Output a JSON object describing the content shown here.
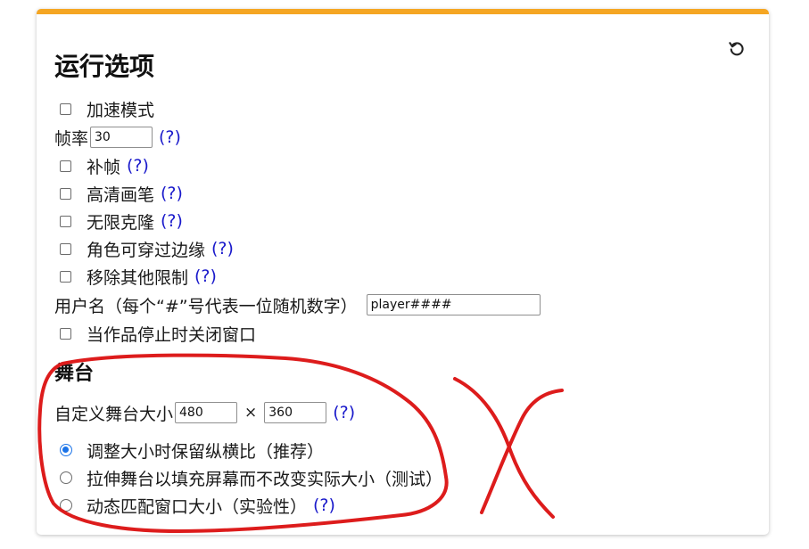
{
  "panel": {
    "title": "运行选项",
    "reset_icon": "reset-icon",
    "accent_color": "#f5a623"
  },
  "options": {
    "turbo_mode": {
      "label": "加速模式",
      "checked": false
    },
    "framerate": {
      "label": "帧率",
      "value": "30",
      "help": "(?)"
    },
    "interpolation": {
      "label": "补帧",
      "help": "(?)",
      "checked": false
    },
    "hq_pen": {
      "label": "高清画笔",
      "help": "(?)",
      "checked": false
    },
    "infinite_clones": {
      "label": "无限克隆",
      "help": "(?)",
      "checked": false
    },
    "fencing": {
      "label": "角色可穿过边缘",
      "help": "(?)",
      "checked": false
    },
    "remove_limits": {
      "label": "移除其他限制",
      "help": "(?)",
      "checked": false
    },
    "username": {
      "label": "用户名（每个“#”号代表一位随机数字）",
      "value": "player####"
    },
    "close_on_stop": {
      "label": "当作品停止时关闭窗口",
      "checked": false
    }
  },
  "stage": {
    "title": "舞台",
    "custom_size_label": "自定义舞台大小",
    "width": "480",
    "times": "×",
    "height": "360",
    "help": "(?)",
    "modes": [
      {
        "label": "调整大小时保留纵横比（推荐）",
        "selected": true
      },
      {
        "label": "拉伸舞台以填充屏幕而不改变实际大小（测试）",
        "selected": false
      },
      {
        "label": "动态匹配窗口大小（实验性）",
        "selected": false
      }
    ],
    "mode3_help": "(?)"
  },
  "annotation": {
    "stroke_color": "#dd1c1c"
  }
}
